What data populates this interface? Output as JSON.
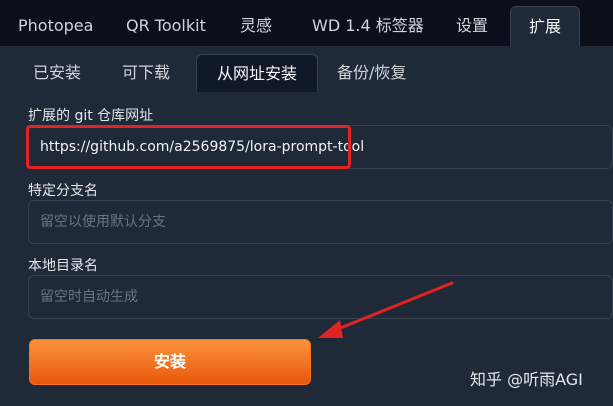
{
  "top_tabs": [
    {
      "label": "Photopea"
    },
    {
      "label": "QR Toolkit"
    },
    {
      "label": "灵感"
    },
    {
      "label": "WD 1.4 标签器"
    },
    {
      "label": "设置"
    },
    {
      "label": "扩展",
      "active": true
    }
  ],
  "sub_tabs": [
    {
      "label": "已安装"
    },
    {
      "label": "可下载"
    },
    {
      "label": "从网址安装",
      "active": true
    },
    {
      "label": "备份/恢复"
    }
  ],
  "form": {
    "url_label": "扩展的 git 仓库网址",
    "url_value": "https://github.com/a2569875/lora-prompt-tool",
    "branch_label": "特定分支名",
    "branch_placeholder": "留空以使用默认分支",
    "dir_label": "本地目录名",
    "dir_placeholder": "留空时自动生成",
    "install_label": "安装"
  },
  "watermark": "知乎 @听雨AGI",
  "colors": {
    "background": "#0b0f19",
    "panel": "#1f2937",
    "accent_orange": "#f97316",
    "highlight_red": "#e02424"
  }
}
